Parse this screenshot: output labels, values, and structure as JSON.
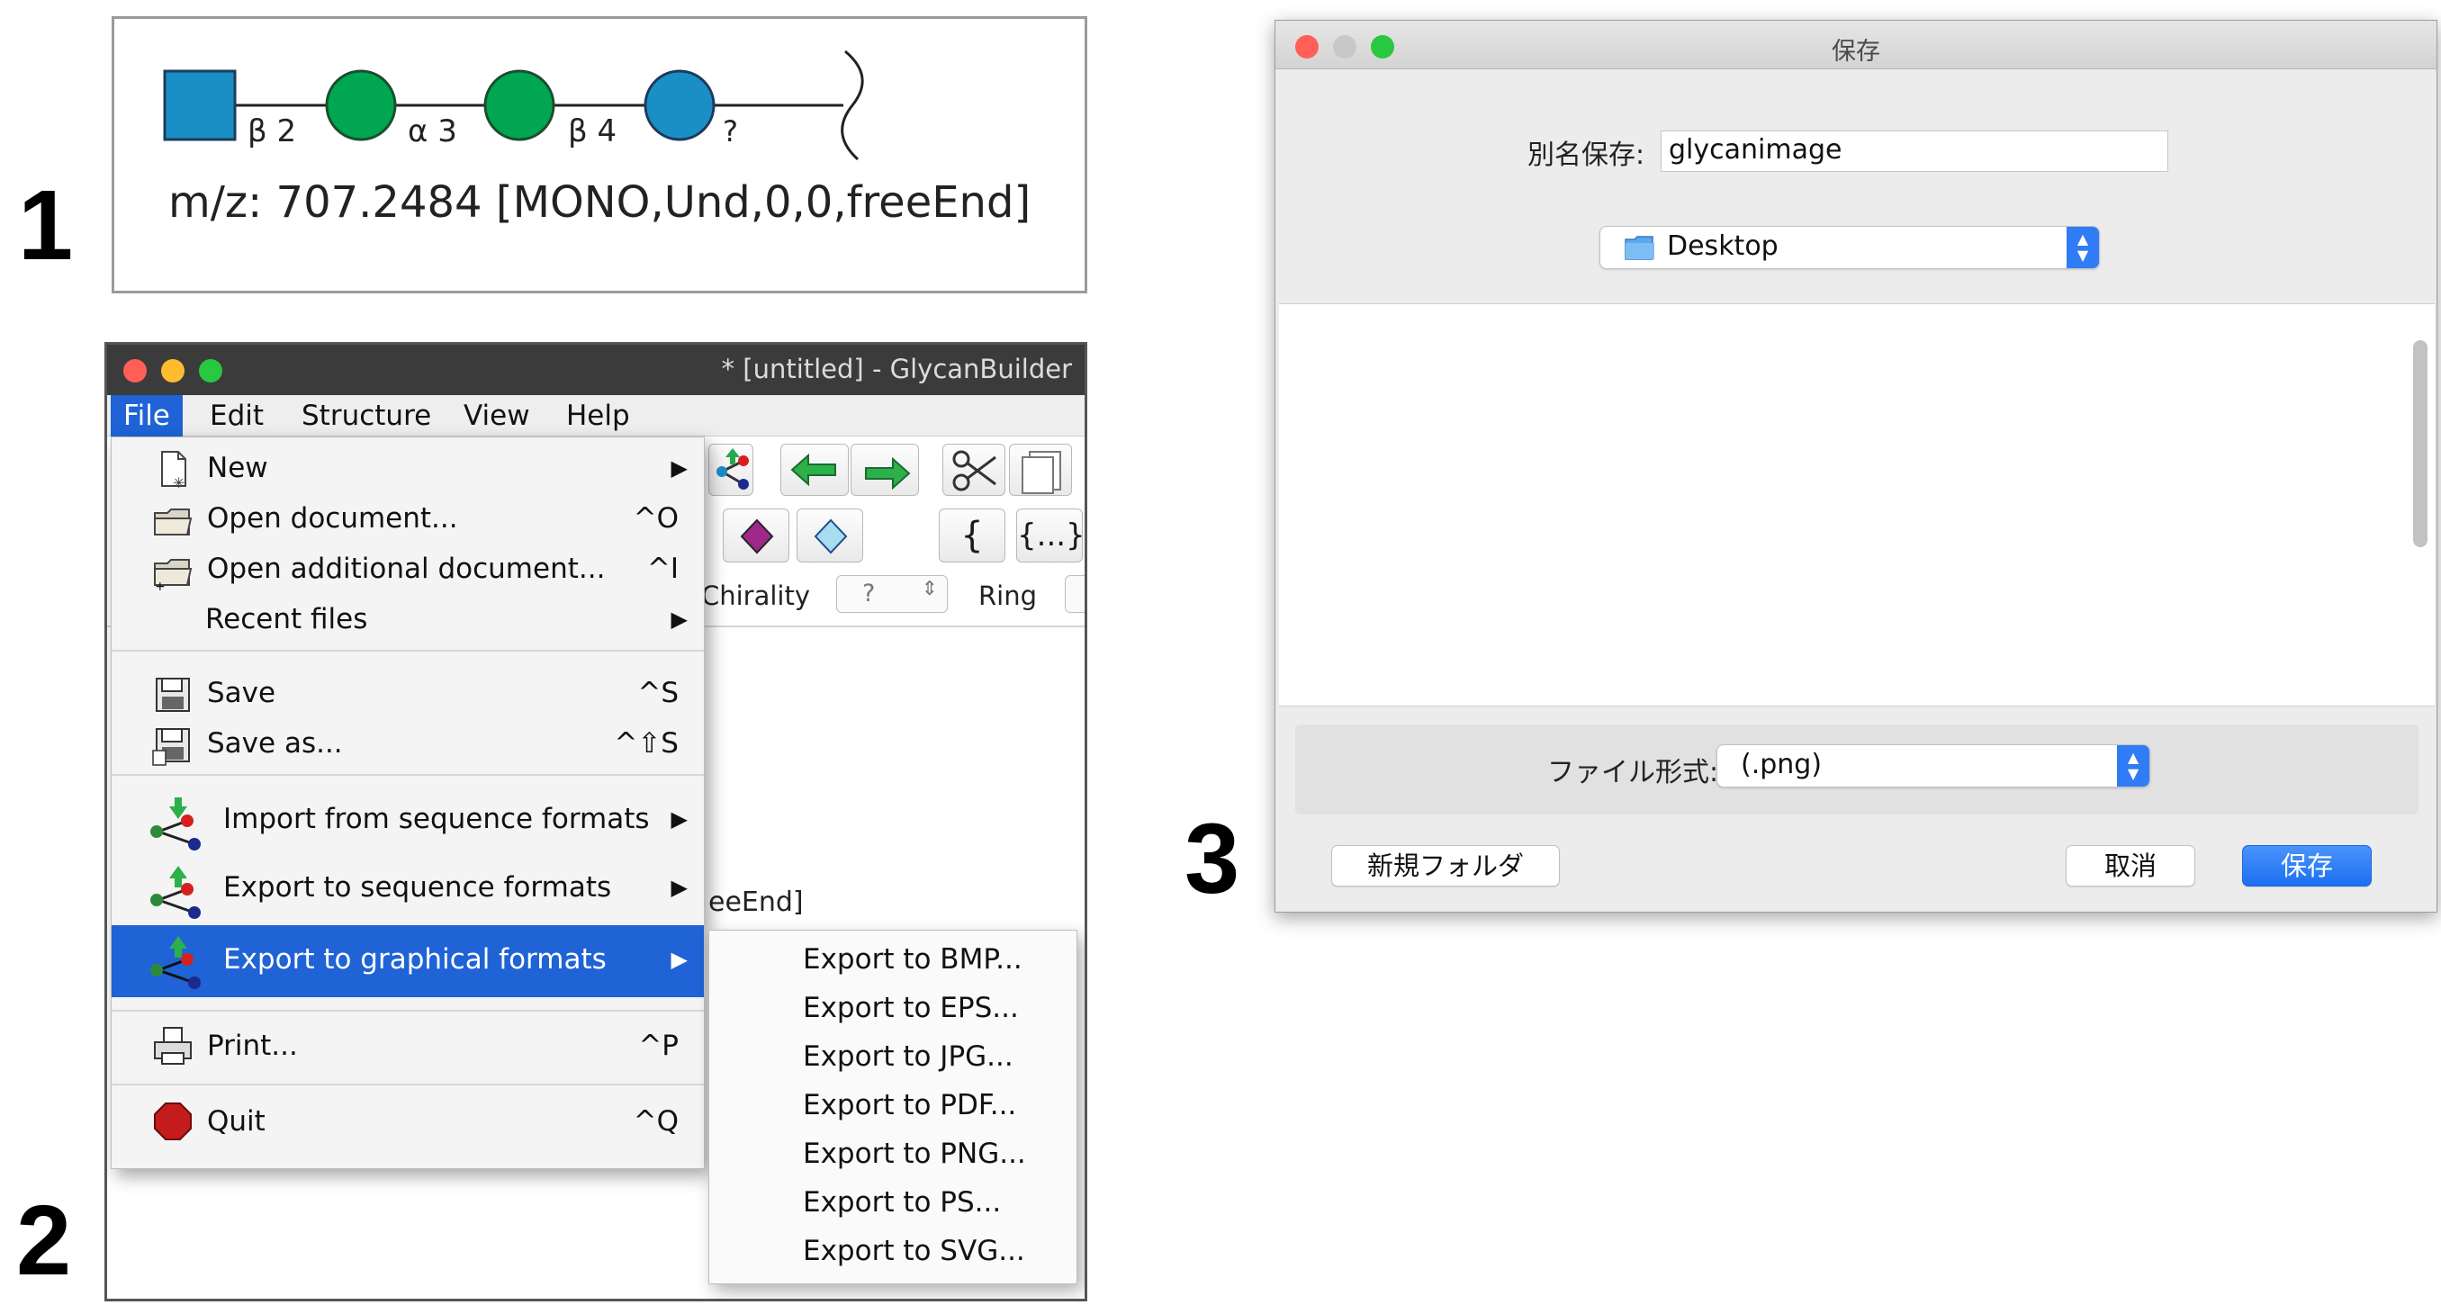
{
  "panel_numbers": {
    "p1": "1",
    "p2": "2",
    "p3": "3"
  },
  "panel1": {
    "glycan": {
      "linkage_labels": [
        "β 2",
        "α 3",
        "β 4",
        "?"
      ],
      "residues": [
        {
          "shape": "square",
          "color": "#1a8fc6"
        },
        {
          "shape": "circle",
          "color": "#00a651"
        },
        {
          "shape": "circle",
          "color": "#00a651"
        },
        {
          "shape": "circle",
          "color": "#1a8fc6"
        }
      ],
      "end_symbol": "reducing-end-bracket"
    },
    "mz_text": "m/z: 707.2484 [MONO,Und,0,0,freeEnd]"
  },
  "panel2": {
    "window_title": "* [untitled] - GlycanBuilder",
    "window_buttons": {
      "close": "#ff5f57",
      "minimize": "#febc2e",
      "zoom": "#28c840"
    },
    "menubar": [
      "File",
      "Edit",
      "Structure",
      "View",
      "Help"
    ],
    "background": {
      "chirality_label": "Chirality",
      "chirality_value": "?",
      "ring_label": "Ring",
      "bracket_open": "{",
      "bracket_repeat": "{...}",
      "partial_text": "eeEnd]"
    },
    "file_menu": [
      {
        "label": "New",
        "shortcut": "",
        "submenu": true,
        "icon": "new-document-icon"
      },
      {
        "label": "Open document...",
        "shortcut": "^O",
        "submenu": false,
        "icon": "folder-icon"
      },
      {
        "label": "Open additional document...",
        "shortcut": "^I",
        "submenu": false,
        "icon": "folder-add-icon"
      },
      {
        "label": "Recent files",
        "shortcut": "",
        "submenu": true,
        "icon": ""
      },
      {
        "label": "Save",
        "shortcut": "^S",
        "submenu": false,
        "icon": "floppy-disk-icon"
      },
      {
        "label": "Save as...",
        "shortcut": "^⇧S",
        "submenu": false,
        "icon": "floppy-disk-as-icon"
      },
      {
        "label": "Import from sequence formats",
        "shortcut": "",
        "submenu": true,
        "icon": "import-sequence-icon"
      },
      {
        "label": "Export to sequence formats",
        "shortcut": "",
        "submenu": true,
        "icon": "export-sequence-icon"
      },
      {
        "label": "Export to graphical formats",
        "shortcut": "",
        "submenu": true,
        "icon": "export-graphical-icon",
        "highlighted": true
      },
      {
        "label": "Print...",
        "shortcut": "^P",
        "submenu": false,
        "icon": "printer-icon"
      },
      {
        "label": "Quit",
        "shortcut": "^Q",
        "submenu": false,
        "icon": "stop-icon"
      }
    ],
    "graphical_submenu": [
      "Export to BMP...",
      "Export to EPS...",
      "Export to JPG...",
      "Export to PDF...",
      "Export to PNG...",
      "Export to PS...",
      "Export to SVG..."
    ]
  },
  "panel3": {
    "dialog_title": "保存",
    "save_as_label": "別名保存:",
    "filename_value": "glycanimage",
    "location_value": "Desktop",
    "file_format_label": "ファイル形式:",
    "file_format_value": "(.png)",
    "new_folder_label": "新規フォルダ",
    "cancel_label": "取消",
    "save_label": "保存",
    "accent_color": "#2f7cf6"
  }
}
